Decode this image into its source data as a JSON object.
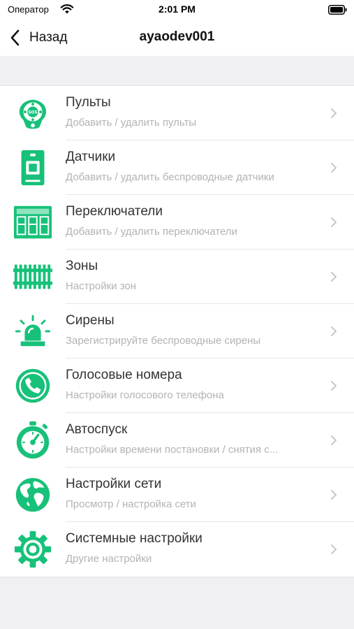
{
  "status_bar": {
    "carrier": "Оператор",
    "time": "2:01 PM",
    "wifi_icon": "wifi-icon",
    "battery_icon": "battery-icon"
  },
  "nav": {
    "back_label": "Назад",
    "back_icon": "chevron-left-icon",
    "title": "ayaodev001"
  },
  "colors": {
    "accent": "#17c179",
    "chevron": "#c7c7cc",
    "subtitle": "#b3b3b3",
    "background": "#efeff4"
  },
  "menu": [
    {
      "title": "Пульты",
      "subtitle": "Добавить / удалить пульты",
      "icon": "remote-control-icon"
    },
    {
      "title": "Датчики",
      "subtitle": "Добавить / удалить беспроводные датчики",
      "icon": "sensor-icon"
    },
    {
      "title": "Переключатели",
      "subtitle": "Добавить / удалить переключатели",
      "icon": "switch-panel-icon"
    },
    {
      "title": "Зоны",
      "subtitle": "Настройки зон",
      "icon": "zones-fence-icon"
    },
    {
      "title": "Сирены",
      "subtitle": "Зарегистрируйте беспроводные сирены",
      "icon": "siren-icon"
    },
    {
      "title": "Голосовые номера",
      "subtitle": "Настройки голосового телефона",
      "icon": "phone-icon"
    },
    {
      "title": "Автоспуск",
      "subtitle": "Настройки времени постановки / снятия с...",
      "icon": "stopwatch-icon"
    },
    {
      "title": "Настройки сети",
      "subtitle": "Просмотр / настройка сети",
      "icon": "globe-icon"
    },
    {
      "title": "Системные настройки",
      "subtitle": "Другие настройки",
      "icon": "gear-icon"
    }
  ]
}
